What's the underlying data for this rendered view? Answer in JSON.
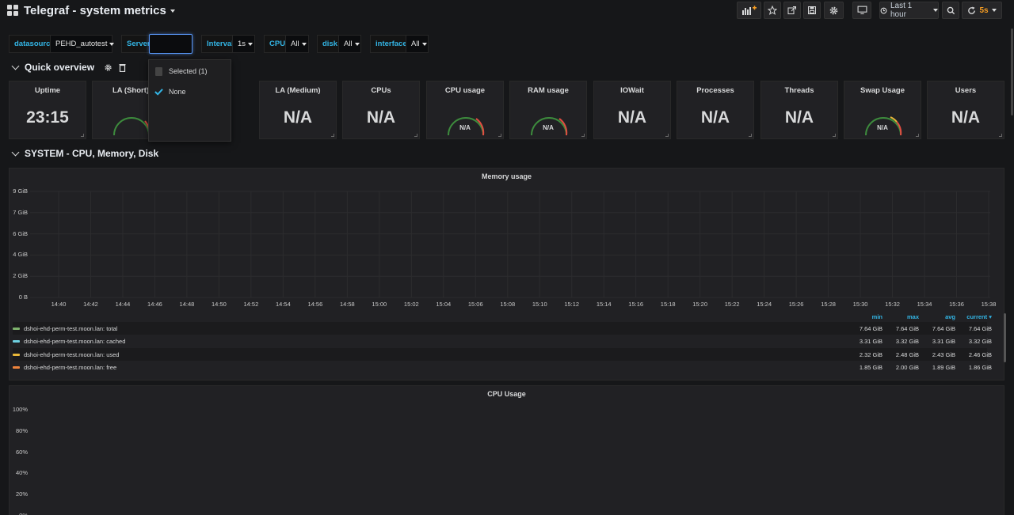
{
  "navbar": {
    "title": "Telegraf - system metrics",
    "time_range": "Last 1 hour",
    "refresh": "5s"
  },
  "variables": [
    {
      "label": "datasource",
      "value": "PEHD_autotest"
    },
    {
      "label": "Server",
      "value": ""
    },
    {
      "label": "Interval",
      "value": "1s"
    },
    {
      "label": "CPU",
      "value": "All"
    },
    {
      "label": "disk",
      "value": "All"
    },
    {
      "label": "interface",
      "value": "All"
    }
  ],
  "server_dropdown": {
    "options": [
      {
        "label": "Selected (1)",
        "checked": false
      },
      {
        "label": "None",
        "checked": true
      }
    ]
  },
  "rows": {
    "quick_overview": "Quick overview",
    "system": "SYSTEM - CPU, Memory, Disk"
  },
  "stat_panels": [
    {
      "title": "Uptime",
      "value": "23:15",
      "kind": "stat"
    },
    {
      "title": "LA (Short)",
      "value": "",
      "kind": "gauge"
    },
    {
      "title": "LA (Medium)",
      "value": "N/A",
      "kind": "stat"
    },
    {
      "title": "CPUs",
      "value": "N/A",
      "kind": "stat"
    },
    {
      "title": "CPU usage",
      "value": "N/A",
      "kind": "gauge"
    },
    {
      "title": "RAM usage",
      "value": "N/A",
      "kind": "gauge"
    },
    {
      "title": "IOWait",
      "value": "N/A",
      "kind": "stat"
    },
    {
      "title": "Processes",
      "value": "N/A",
      "kind": "stat"
    },
    {
      "title": "Threads",
      "value": "N/A",
      "kind": "stat"
    },
    {
      "title": "Swap Usage",
      "value": "N/A",
      "kind": "gauge"
    },
    {
      "title": "Users",
      "value": "N/A",
      "kind": "stat"
    }
  ],
  "memory_graph": {
    "title": "Memory usage",
    "y_ticks": [
      "9 GiB",
      "7 GiB",
      "6 GiB",
      "4 GiB",
      "2 GiB",
      "0 B"
    ],
    "x_ticks": [
      "14:40",
      "14:42",
      "14:44",
      "14:46",
      "14:48",
      "14:50",
      "14:52",
      "14:54",
      "14:56",
      "14:58",
      "15:00",
      "15:02",
      "15:04",
      "15:06",
      "15:08",
      "15:10",
      "15:12",
      "15:14",
      "15:16",
      "15:18",
      "15:20",
      "15:22",
      "15:24",
      "15:26",
      "15:28",
      "15:30",
      "15:32",
      "15:34",
      "15:36",
      "15:38"
    ],
    "legend_headers": [
      "min",
      "max",
      "avg",
      "current"
    ],
    "legend": [
      {
        "name": "dshoi-ehd-perm-test.moon.lan: total",
        "color": "#7eb26d",
        "min": "7.64 GiB",
        "max": "7.64 GiB",
        "avg": "7.64 GiB",
        "current": "7.64 GiB"
      },
      {
        "name": "dshoi-ehd-perm-test.moon.lan: cached",
        "color": "#6ed0e0",
        "min": "3.31 GiB",
        "max": "3.32 GiB",
        "avg": "3.31 GiB",
        "current": "3.32 GiB"
      },
      {
        "name": "dshoi-ehd-perm-test.moon.lan: used",
        "color": "#eab839",
        "min": "2.32 GiB",
        "max": "2.48 GiB",
        "avg": "2.43 GiB",
        "current": "2.46 GiB"
      },
      {
        "name": "dshoi-ehd-perm-test.moon.lan: free",
        "color": "#ef843c",
        "min": "1.85 GiB",
        "max": "2.00 GiB",
        "avg": "1.89 GiB",
        "current": "1.86 GiB"
      }
    ]
  },
  "cpu_graph": {
    "title": "CPU Usage",
    "y_ticks": [
      "100%",
      "80%",
      "60%",
      "40%",
      "20%",
      "0%"
    ]
  }
}
